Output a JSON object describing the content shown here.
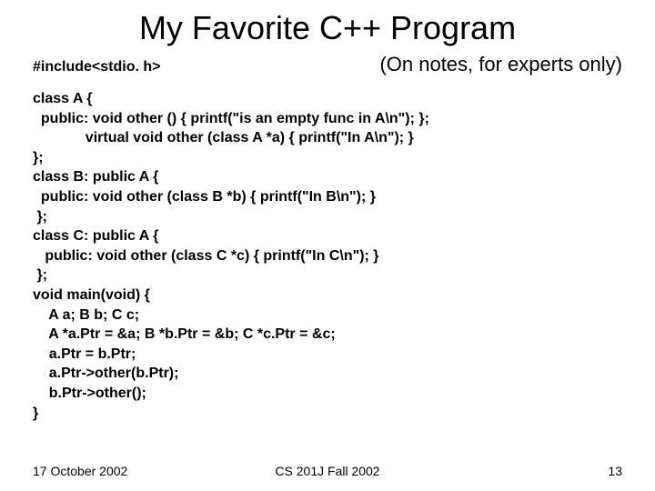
{
  "title": "My Favorite C++ Program",
  "include": "#include<stdio. h>",
  "note": "(On notes, for experts only)",
  "code": "class A {\n  public: void other () { printf(\"is an empty func in A\\n\"); };\n             virtual void other (class A *a) { printf(\"In A\\n\"); }\n};\nclass B: public A {\n  public: void other (class B *b) { printf(\"In B\\n\"); }\n };\nclass C: public A {\n   public: void other (class C *c) { printf(\"In C\\n\"); }\n };\nvoid main(void) {\n    A a; B b; C c;\n    A *a.Ptr = &a; B *b.Ptr = &b; C *c.Ptr = &c;\n    a.Ptr = b.Ptr;\n    a.Ptr->other(b.Ptr);\n    b.Ptr->other();\n}",
  "footer": {
    "date": "17 October 2002",
    "course": "CS 201J Fall 2002",
    "page": "13"
  }
}
